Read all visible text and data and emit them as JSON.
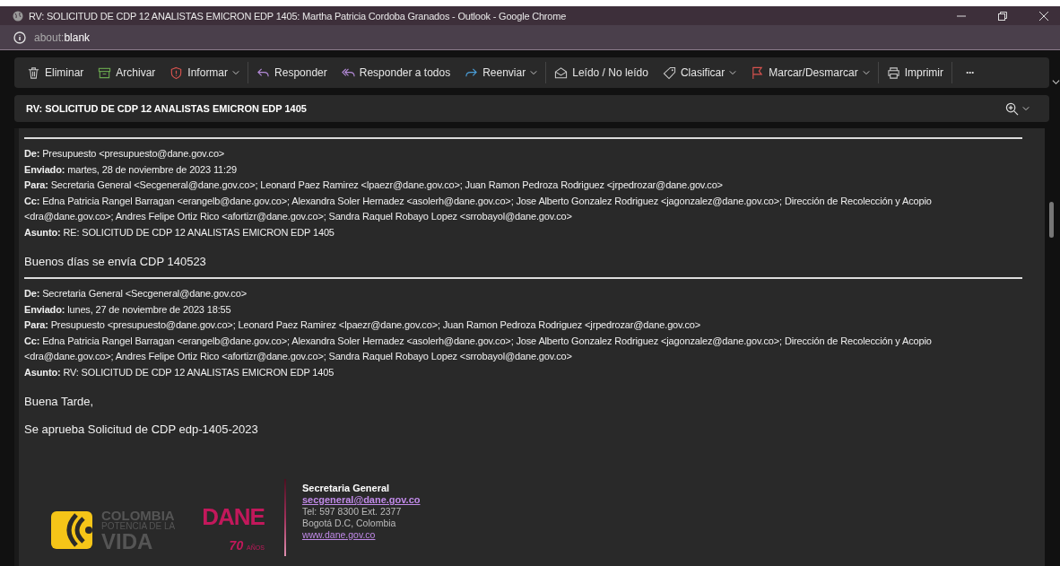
{
  "browser": {
    "title": "RV: SOLICITUD DE CDP 12 ANALISTAS EMICRON EDP 1405: Martha Patricia Cordoba Granados - Outlook - Google Chrome",
    "address_prefix": "about:",
    "address_host": "blank"
  },
  "toolbar_groups": [
    [
      {
        "kind": "trash",
        "label": "Eliminar",
        "dropdown": false
      },
      {
        "kind": "archive",
        "label": "Archivar",
        "dropdown": false
      },
      {
        "kind": "shield",
        "label": "Informar",
        "dropdown": true
      }
    ],
    [
      {
        "kind": "reply",
        "label": "Responder",
        "dropdown": false
      },
      {
        "kind": "reply_all",
        "label": "Responder a todos",
        "dropdown": false
      },
      {
        "kind": "forward",
        "label": "Reenviar",
        "dropdown": true
      }
    ],
    [
      {
        "kind": "envelope",
        "label": "Leído / No leído",
        "dropdown": false
      },
      {
        "kind": "tag",
        "label": "Clasificar",
        "dropdown": true
      },
      {
        "kind": "flag",
        "label": "Marcar/Desmarcar",
        "dropdown": true
      }
    ],
    [
      {
        "kind": "print",
        "label": "Imprimir",
        "dropdown": false
      }
    ],
    [
      {
        "kind": "more",
        "label": "···",
        "dropdown": false
      }
    ]
  ],
  "subject": "RV: SOLICITUD DE CDP 12 ANALISTAS EMICRON EDP 1405",
  "messages": [
    {
      "headers": [
        "**De:** Presupuesto <presupuesto@dane.gov.co>",
        "**Enviado:** martes, 28 de noviembre de 2023 11:29",
        "**Para:** Secretaria General <Secgeneral@dane.gov.co>; Leonard Paez Ramirez <lpaezr@dane.gov.co>; Juan Ramon Pedroza Rodriguez <jrpedrozar@dane.gov.co>",
        "**Cc:** Edna Patricia Rangel Barragan <erangelb@dane.gov.co>; Alexandra Soler Hernadez <asolerh@dane.gov.co>; Jose Alberto Gonzalez Rodriguez <jagonzalez@dane.gov.co>; Dirección de Recolección y Acopio <dra@dane.gov.co>; Andres Felipe Ortiz Rico <afortizr@dane.gov.co>; Sandra Raquel Robayo Lopez <srrobayol@dane.gov.co>",
        "**Asunto:** RE: SOLICITUD DE CDP 12 ANALISTAS EMICRON EDP 1405"
      ],
      "body": [
        "Buenos días se envía CDP 140523"
      ]
    },
    {
      "headers": [
        "**De:** Secretaria General <Secgeneral@dane.gov.co>",
        "**Enviado:** lunes, 27 de noviembre de 2023 18:55",
        "**Para:** Presupuesto <presupuesto@dane.gov.co>; Leonard Paez Ramirez <lpaezr@dane.gov.co>; Juan Ramon Pedroza Rodriguez <jrpedrozar@dane.gov.co>",
        "**Cc:** Edna Patricia Rangel Barragan <erangelb@dane.gov.co>; Alexandra Soler Hernadez <asolerh@dane.gov.co>; Jose Alberto Gonzalez Rodriguez <jagonzalez@dane.gov.co>; Dirección de Recolección y Acopio <dra@dane.gov.co>; Andres Felipe Ortiz Rico <afortizr@dane.gov.co>; Sandra Raquel Robayo Lopez <srrobayol@dane.gov.co>",
        "**Asunto:** RV: SOLICITUD DE CDP 12 ANALISTAS EMICRON EDP 1405"
      ],
      "body": [
        "Buena Tarde,",
        "Se aprueba Solicitud de CDP edp-1405-2023"
      ]
    }
  ],
  "signature": {
    "logo1": [
      "COLOMBIA",
      "POTENCIA DE LA",
      "VIDA"
    ],
    "logo2": {
      "name": "DANE",
      "years": "70",
      "years_unit": "AÑOS"
    },
    "name": "Secretaria General",
    "email": "secgeneral@dane.gov.co",
    "phone": "Tel: 597 8300 Ext. 2377",
    "city": "Bogotá D.C, Colombia",
    "web": "www.dane.gov.co"
  }
}
